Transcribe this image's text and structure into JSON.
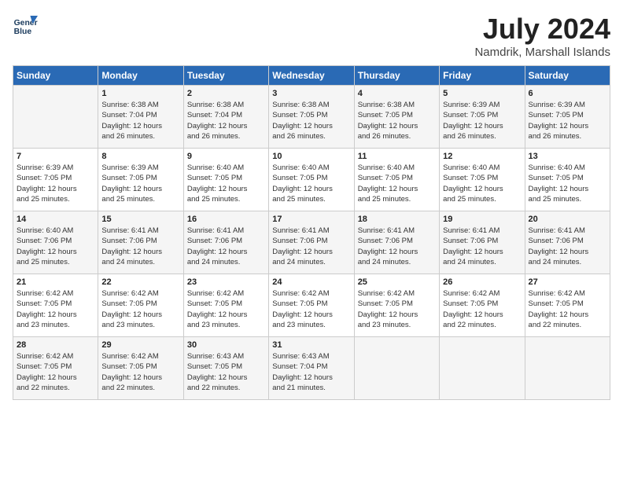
{
  "header": {
    "logo_line1": "General",
    "logo_line2": "Blue",
    "month_year": "July 2024",
    "location": "Namdrik, Marshall Islands"
  },
  "weekdays": [
    "Sunday",
    "Monday",
    "Tuesday",
    "Wednesday",
    "Thursday",
    "Friday",
    "Saturday"
  ],
  "weeks": [
    [
      {
        "day": "",
        "info": ""
      },
      {
        "day": "1",
        "info": "Sunrise: 6:38 AM\nSunset: 7:04 PM\nDaylight: 12 hours\nand 26 minutes."
      },
      {
        "day": "2",
        "info": "Sunrise: 6:38 AM\nSunset: 7:04 PM\nDaylight: 12 hours\nand 26 minutes."
      },
      {
        "day": "3",
        "info": "Sunrise: 6:38 AM\nSunset: 7:05 PM\nDaylight: 12 hours\nand 26 minutes."
      },
      {
        "day": "4",
        "info": "Sunrise: 6:38 AM\nSunset: 7:05 PM\nDaylight: 12 hours\nand 26 minutes."
      },
      {
        "day": "5",
        "info": "Sunrise: 6:39 AM\nSunset: 7:05 PM\nDaylight: 12 hours\nand 26 minutes."
      },
      {
        "day": "6",
        "info": "Sunrise: 6:39 AM\nSunset: 7:05 PM\nDaylight: 12 hours\nand 26 minutes."
      }
    ],
    [
      {
        "day": "7",
        "info": "Sunrise: 6:39 AM\nSunset: 7:05 PM\nDaylight: 12 hours\nand 25 minutes."
      },
      {
        "day": "8",
        "info": "Sunrise: 6:39 AM\nSunset: 7:05 PM\nDaylight: 12 hours\nand 25 minutes."
      },
      {
        "day": "9",
        "info": "Sunrise: 6:40 AM\nSunset: 7:05 PM\nDaylight: 12 hours\nand 25 minutes."
      },
      {
        "day": "10",
        "info": "Sunrise: 6:40 AM\nSunset: 7:05 PM\nDaylight: 12 hours\nand 25 minutes."
      },
      {
        "day": "11",
        "info": "Sunrise: 6:40 AM\nSunset: 7:05 PM\nDaylight: 12 hours\nand 25 minutes."
      },
      {
        "day": "12",
        "info": "Sunrise: 6:40 AM\nSunset: 7:05 PM\nDaylight: 12 hours\nand 25 minutes."
      },
      {
        "day": "13",
        "info": "Sunrise: 6:40 AM\nSunset: 7:05 PM\nDaylight: 12 hours\nand 25 minutes."
      }
    ],
    [
      {
        "day": "14",
        "info": "Sunrise: 6:40 AM\nSunset: 7:06 PM\nDaylight: 12 hours\nand 25 minutes."
      },
      {
        "day": "15",
        "info": "Sunrise: 6:41 AM\nSunset: 7:06 PM\nDaylight: 12 hours\nand 24 minutes."
      },
      {
        "day": "16",
        "info": "Sunrise: 6:41 AM\nSunset: 7:06 PM\nDaylight: 12 hours\nand 24 minutes."
      },
      {
        "day": "17",
        "info": "Sunrise: 6:41 AM\nSunset: 7:06 PM\nDaylight: 12 hours\nand 24 minutes."
      },
      {
        "day": "18",
        "info": "Sunrise: 6:41 AM\nSunset: 7:06 PM\nDaylight: 12 hours\nand 24 minutes."
      },
      {
        "day": "19",
        "info": "Sunrise: 6:41 AM\nSunset: 7:06 PM\nDaylight: 12 hours\nand 24 minutes."
      },
      {
        "day": "20",
        "info": "Sunrise: 6:41 AM\nSunset: 7:06 PM\nDaylight: 12 hours\nand 24 minutes."
      }
    ],
    [
      {
        "day": "21",
        "info": "Sunrise: 6:42 AM\nSunset: 7:05 PM\nDaylight: 12 hours\nand 23 minutes."
      },
      {
        "day": "22",
        "info": "Sunrise: 6:42 AM\nSunset: 7:05 PM\nDaylight: 12 hours\nand 23 minutes."
      },
      {
        "day": "23",
        "info": "Sunrise: 6:42 AM\nSunset: 7:05 PM\nDaylight: 12 hours\nand 23 minutes."
      },
      {
        "day": "24",
        "info": "Sunrise: 6:42 AM\nSunset: 7:05 PM\nDaylight: 12 hours\nand 23 minutes."
      },
      {
        "day": "25",
        "info": "Sunrise: 6:42 AM\nSunset: 7:05 PM\nDaylight: 12 hours\nand 23 minutes."
      },
      {
        "day": "26",
        "info": "Sunrise: 6:42 AM\nSunset: 7:05 PM\nDaylight: 12 hours\nand 22 minutes."
      },
      {
        "day": "27",
        "info": "Sunrise: 6:42 AM\nSunset: 7:05 PM\nDaylight: 12 hours\nand 22 minutes."
      }
    ],
    [
      {
        "day": "28",
        "info": "Sunrise: 6:42 AM\nSunset: 7:05 PM\nDaylight: 12 hours\nand 22 minutes."
      },
      {
        "day": "29",
        "info": "Sunrise: 6:42 AM\nSunset: 7:05 PM\nDaylight: 12 hours\nand 22 minutes."
      },
      {
        "day": "30",
        "info": "Sunrise: 6:43 AM\nSunset: 7:05 PM\nDaylight: 12 hours\nand 22 minutes."
      },
      {
        "day": "31",
        "info": "Sunrise: 6:43 AM\nSunset: 7:04 PM\nDaylight: 12 hours\nand 21 minutes."
      },
      {
        "day": "",
        "info": ""
      },
      {
        "day": "",
        "info": ""
      },
      {
        "day": "",
        "info": ""
      }
    ]
  ]
}
